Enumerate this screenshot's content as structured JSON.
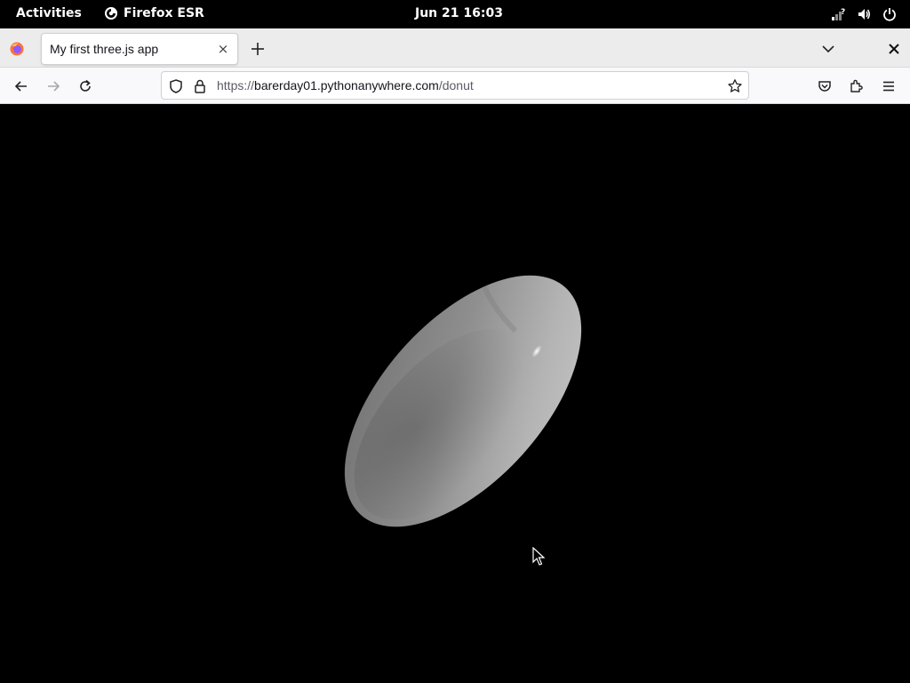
{
  "topbar": {
    "activities": "Activities",
    "app_name": "Firefox ESR",
    "clock": "Jun 21  16:03"
  },
  "tabs": [
    {
      "title": "My first three.js app",
      "close": "×"
    }
  ],
  "navbar": {
    "url_prefix": "https://",
    "url_host": "barerday01.pythonanywhere.com",
    "url_path": "/donut"
  },
  "icons": {
    "back": "back-arrow-icon",
    "forward": "forward-arrow-icon",
    "reload": "reload-icon",
    "shield": "tracking-protection-icon",
    "lock": "lock-icon",
    "star": "bookmark-star-icon",
    "pocket": "pocket-icon",
    "extensions": "extensions-icon",
    "menu": "hamburger-menu-icon"
  },
  "colors": {
    "content_background": "#000000",
    "shape_light": "#c8c8c8",
    "shape_dark": "#6e6e6e"
  }
}
